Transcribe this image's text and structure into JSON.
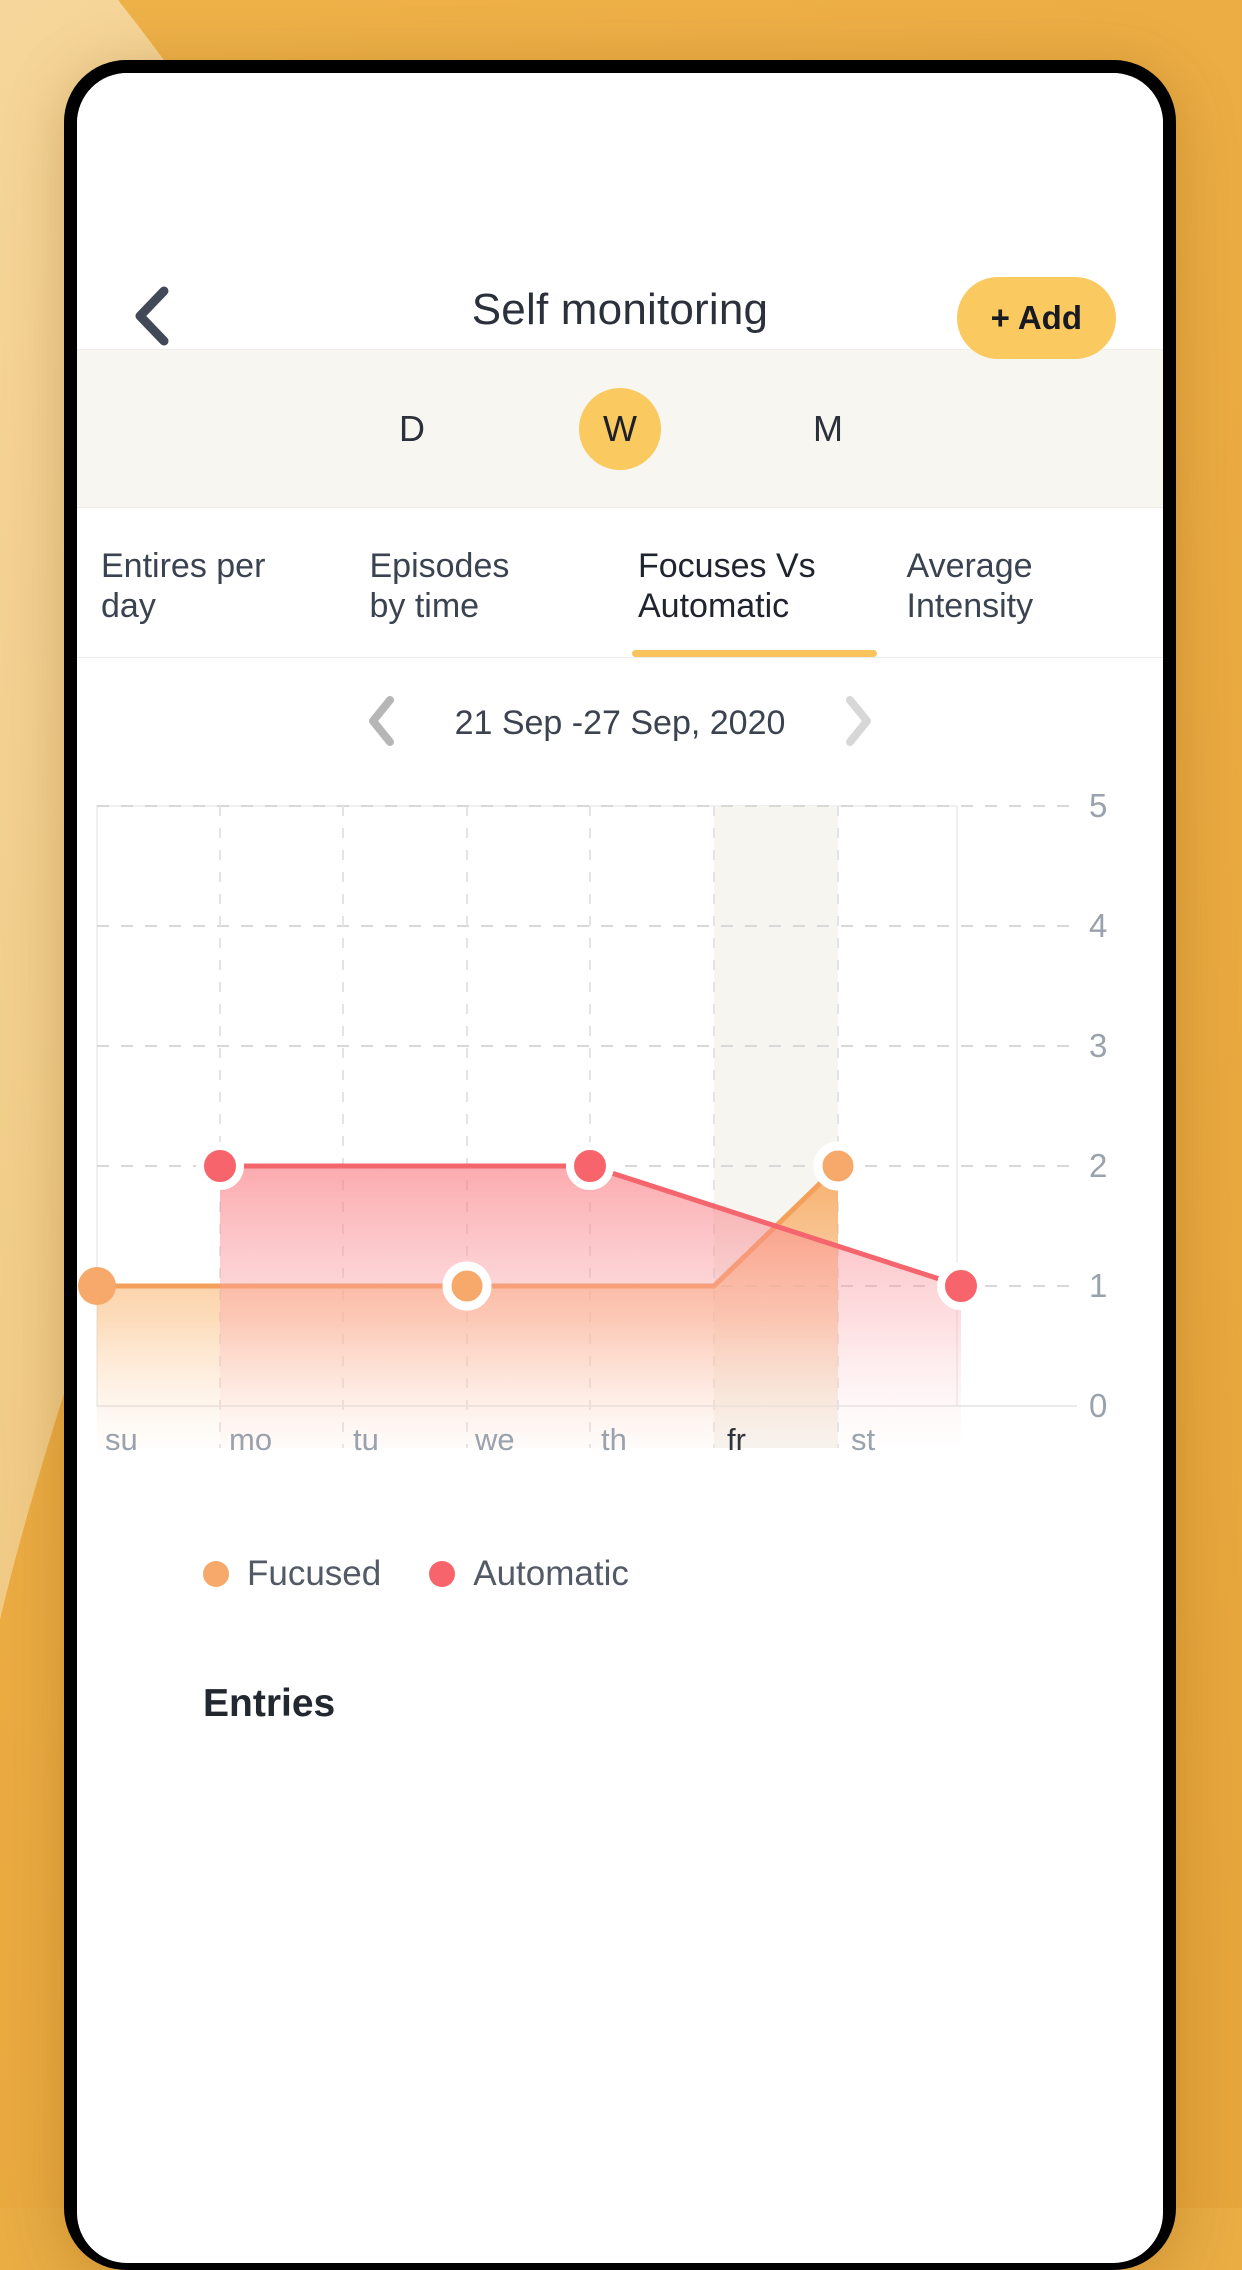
{
  "background": {
    "light": "#f2cd86",
    "dark": "#e9ab3f"
  },
  "theme": {
    "accent": "#fac95f",
    "focused": "#f6a96a",
    "automatic": "#f8646b",
    "text": "#2b303b",
    "muted": "#9aa2ad"
  },
  "header": {
    "back_icon": "chevron-left-icon",
    "title": "Self monitoring",
    "add_label": "+ Add"
  },
  "period": {
    "items": [
      {
        "label": "D",
        "selected": false
      },
      {
        "label": "W",
        "selected": true
      },
      {
        "label": "M",
        "selected": false
      }
    ]
  },
  "tabs": [
    {
      "label": "Entires per\nday",
      "active": false
    },
    {
      "label": "Episodes\nby time",
      "active": false
    },
    {
      "label": "Focuses Vs\nAutomatic",
      "active": true
    },
    {
      "label": "Average\nIntensity",
      "active": false
    }
  ],
  "date_nav": {
    "prev_icon": "chevron-left-icon",
    "next_icon": "chevron-right-icon",
    "range": "21 Sep -27 Sep, 2020"
  },
  "legend": [
    {
      "label": "Fucused",
      "color": "#f6a96a"
    },
    {
      "label": "Automatic",
      "color": "#f8646b"
    }
  ],
  "entries_heading": "Entries",
  "chart_data": {
    "type": "area",
    "title": "",
    "xlabel": "",
    "ylabel": "",
    "categories": [
      "su",
      "mo",
      "tu",
      "we",
      "th",
      "fr",
      "st"
    ],
    "yticks": [
      0,
      1,
      2,
      3,
      4,
      5
    ],
    "ylim": [
      0,
      5
    ],
    "grid": true,
    "legend_position": "bottom-left",
    "highlight_category": "fr",
    "series": [
      {
        "name": "Fucused",
        "color": "#f6a96a",
        "x": [
          "su",
          "we",
          "fr"
        ],
        "values": [
          1,
          1,
          2
        ],
        "markers": [
          {
            "x": "su",
            "y": 1,
            "style": "filled"
          },
          {
            "x": "we",
            "y": 1,
            "style": "ringed"
          },
          {
            "x": "fr",
            "y": 2,
            "style": "ringed"
          }
        ]
      },
      {
        "name": "Automatic",
        "color": "#f8646b",
        "x": [
          "mo",
          "th",
          "st"
        ],
        "values": [
          2,
          2,
          1
        ],
        "markers": [
          {
            "x": "mo",
            "y": 2,
            "style": "filled"
          },
          {
            "x": "th",
            "y": 2,
            "style": "filled"
          },
          {
            "x": "st",
            "y": 1,
            "style": "filled"
          }
        ]
      }
    ]
  }
}
